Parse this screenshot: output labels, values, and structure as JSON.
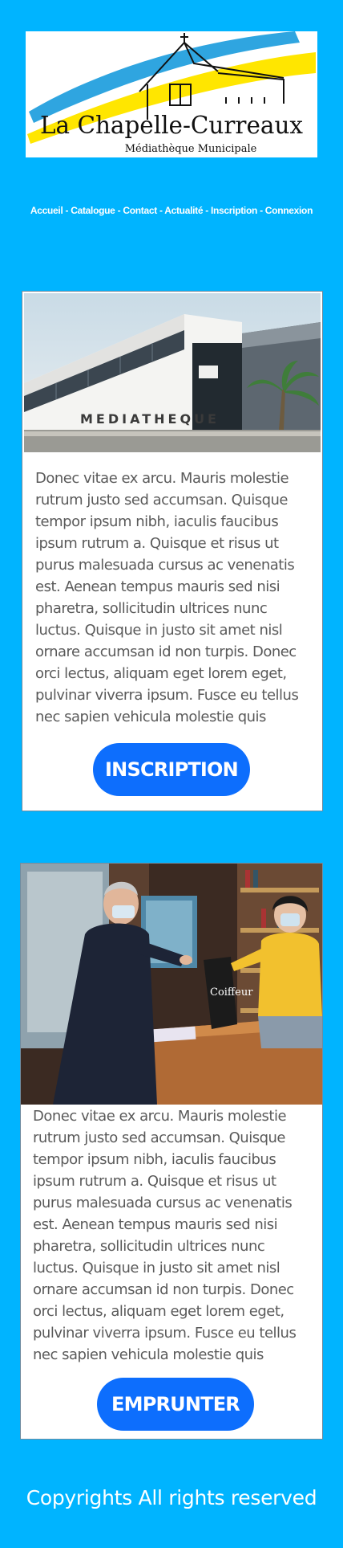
{
  "header": {
    "logo_title": "La Chapelle-Curreaux",
    "logo_subtitle": "Médiathèque Municipale"
  },
  "nav": {
    "items": [
      "Accueil",
      "Catalogue",
      "Contact",
      "Actualité",
      "Inscription",
      "Connexion"
    ],
    "separator": " - "
  },
  "cards": [
    {
      "image_alt": "MEDIATHEQUE",
      "text": "Donec vitae ex arcu. Mauris molestie rutrum justo sed accumsan. Quisque tempor ipsum nibh, iaculis faucibus ipsum rutrum a. Quisque et risus ut purus malesuada cursus ac venenatis est. Aenean tempus mauris sed nisi pharetra, sollicitudin ultrices nunc luctus. Quisque in justo sit amet nisl ornare accumsan id non turpis. Donec orci lectus, aliquam eget lorem eget, pulvinar viverra ipsum. Fusce eu tellus nec sapien vehicula molestie quis",
      "button": "INSCRIPTION"
    },
    {
      "image_alt": "Coiffeur",
      "text": "Donec vitae ex arcu. Mauris molestie rutrum justo sed accumsan. Quisque tempor ipsum nibh, iaculis faucibus ipsum rutrum a. Quisque et risus ut purus malesuada cursus ac venenatis est. Aenean tempus mauris sed nisi pharetra, sollicitudin ultrices nunc luctus. Quisque in justo sit amet nisl ornare accumsan id non turpis. Donec orci lectus, aliquam eget lorem eget, pulvinar viverra ipsum. Fusce eu tellus nec sapien vehicula molestie quis",
      "button": "EMPRUNTER"
    }
  ],
  "footer": {
    "text": "Copyrights All rights reserved"
  },
  "colors": {
    "page_bg": "#00b4ff",
    "button_bg": "#0d6efd",
    "logo_blue": "#2fa5e0",
    "logo_yellow": "#ffe600"
  }
}
